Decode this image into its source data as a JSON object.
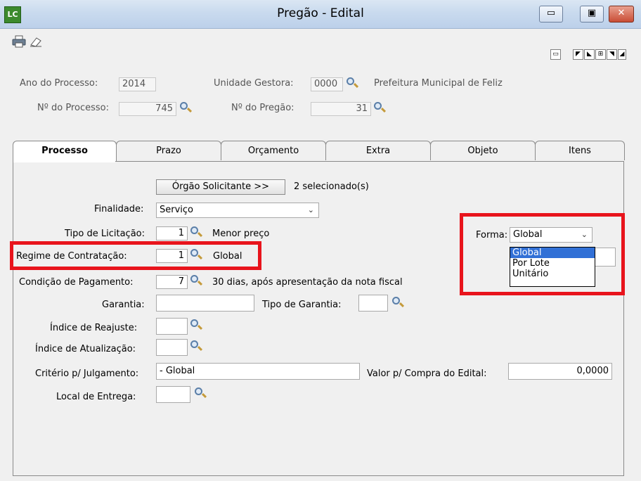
{
  "window": {
    "app_icon_text": "LC",
    "title": "Pregão - Edital",
    "minimize": "▭",
    "maximize": "▣",
    "close": "✕"
  },
  "toolbar": {
    "print_icon": "printer-icon",
    "eraser_icon": "eraser-icon"
  },
  "header": {
    "ano_label": "Ano do Processo:",
    "ano_value": "2014",
    "unidade_label": "Unidade Gestora:",
    "unidade_value": "0000",
    "unidade_name": "Prefeitura Municipal de Feliz",
    "nprocesso_label": "Nº do Processo:",
    "nprocesso_value": "745",
    "npregao_label": "Nº do Pregão:",
    "npregao_value": "31"
  },
  "tabs": [
    {
      "label": "Processo",
      "active": true
    },
    {
      "label": "Prazo"
    },
    {
      "label": "Orçamento"
    },
    {
      "label": "Extra"
    },
    {
      "label": "Objeto"
    },
    {
      "label": "Itens"
    }
  ],
  "form": {
    "orgao_button": "Órgão Solicitante >>",
    "orgao_status": "2 selecionado(s)",
    "finalidade_label": "Finalidade:",
    "finalidade_value": "Serviço",
    "tipo_label": "Tipo de Licitação:",
    "tipo_value": "1",
    "tipo_desc": "Menor preço",
    "regime_label": "Regime de Contratação:",
    "regime_value": "1",
    "regime_desc": "Global",
    "condicao_label": "Condição de Pagamento:",
    "condicao_value": "7",
    "condicao_desc": "30 dias, após apresentação da nota fiscal",
    "garantia_label": "Garantia:",
    "garantia_value": "",
    "tipo_garantia_label": "Tipo de Garantia:",
    "tipo_garantia_value": "",
    "reajuste_label": "Índice de Reajuste:",
    "reajuste_value": "",
    "atualizacao_label": "Índice de Atualização:",
    "atualizacao_value": "",
    "criterio_label": "Critério p/ Julgamento:",
    "criterio_value": "- Global",
    "valor_label": "Valor p/ Compra do Edital:",
    "valor_value": "0,0000",
    "local_label": "Local de Entrega:",
    "local_value": "",
    "forma_label": "Forma:",
    "forma_value": "Global",
    "forma_options": [
      "Global",
      "Por Lote",
      "Unitário"
    ]
  },
  "colors": {
    "highlight_red": "#e8141c",
    "selection_blue": "#3170d6"
  }
}
